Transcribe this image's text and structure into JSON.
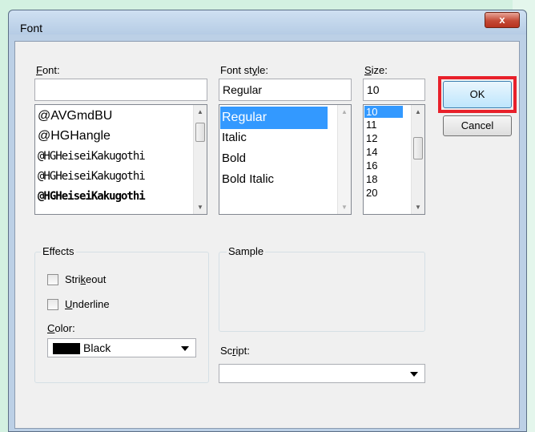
{
  "dialog": {
    "title": "Font",
    "close_label": "x"
  },
  "font": {
    "label_prefix": "",
    "label_underlined": "F",
    "label_rest": "ont:",
    "value": "",
    "items": [
      "@AVGmdBU",
      "@HGHangle",
      "@HGHeiseiKakugothi",
      "@HGHeiseiKakugothi",
      "@HGHeiseiKakugothi"
    ]
  },
  "style": {
    "label_prefix": "Font st",
    "label_underlined": "y",
    "label_rest": "le:",
    "value": "Regular",
    "items": [
      "Regular",
      "Italic",
      "Bold",
      "Bold Italic"
    ],
    "selected": "Regular"
  },
  "size": {
    "label_prefix": "",
    "label_underlined": "S",
    "label_rest": "ize:",
    "value": "10",
    "items": [
      "10",
      "11",
      "12",
      "14",
      "16",
      "18",
      "20"
    ],
    "selected": "10"
  },
  "buttons": {
    "ok": "OK",
    "cancel": "Cancel"
  },
  "effects": {
    "title": "Effects",
    "strikeout_prefix": "Stri",
    "strikeout_underlined": "k",
    "strikeout_rest": "eout",
    "underline_prefix": "",
    "underline_underlined": "U",
    "underline_rest": "nderline",
    "color_prefix": "",
    "color_underlined": "C",
    "color_rest": "olor:",
    "color_value": "Black",
    "color_hex": "#000000"
  },
  "sample": {
    "title": "Sample"
  },
  "script": {
    "label_prefix": "Sc",
    "label_underlined": "r",
    "label_rest": "ipt:",
    "value": ""
  },
  "colors": {
    "selection": "#3399ff",
    "highlight": "#e8202a"
  }
}
